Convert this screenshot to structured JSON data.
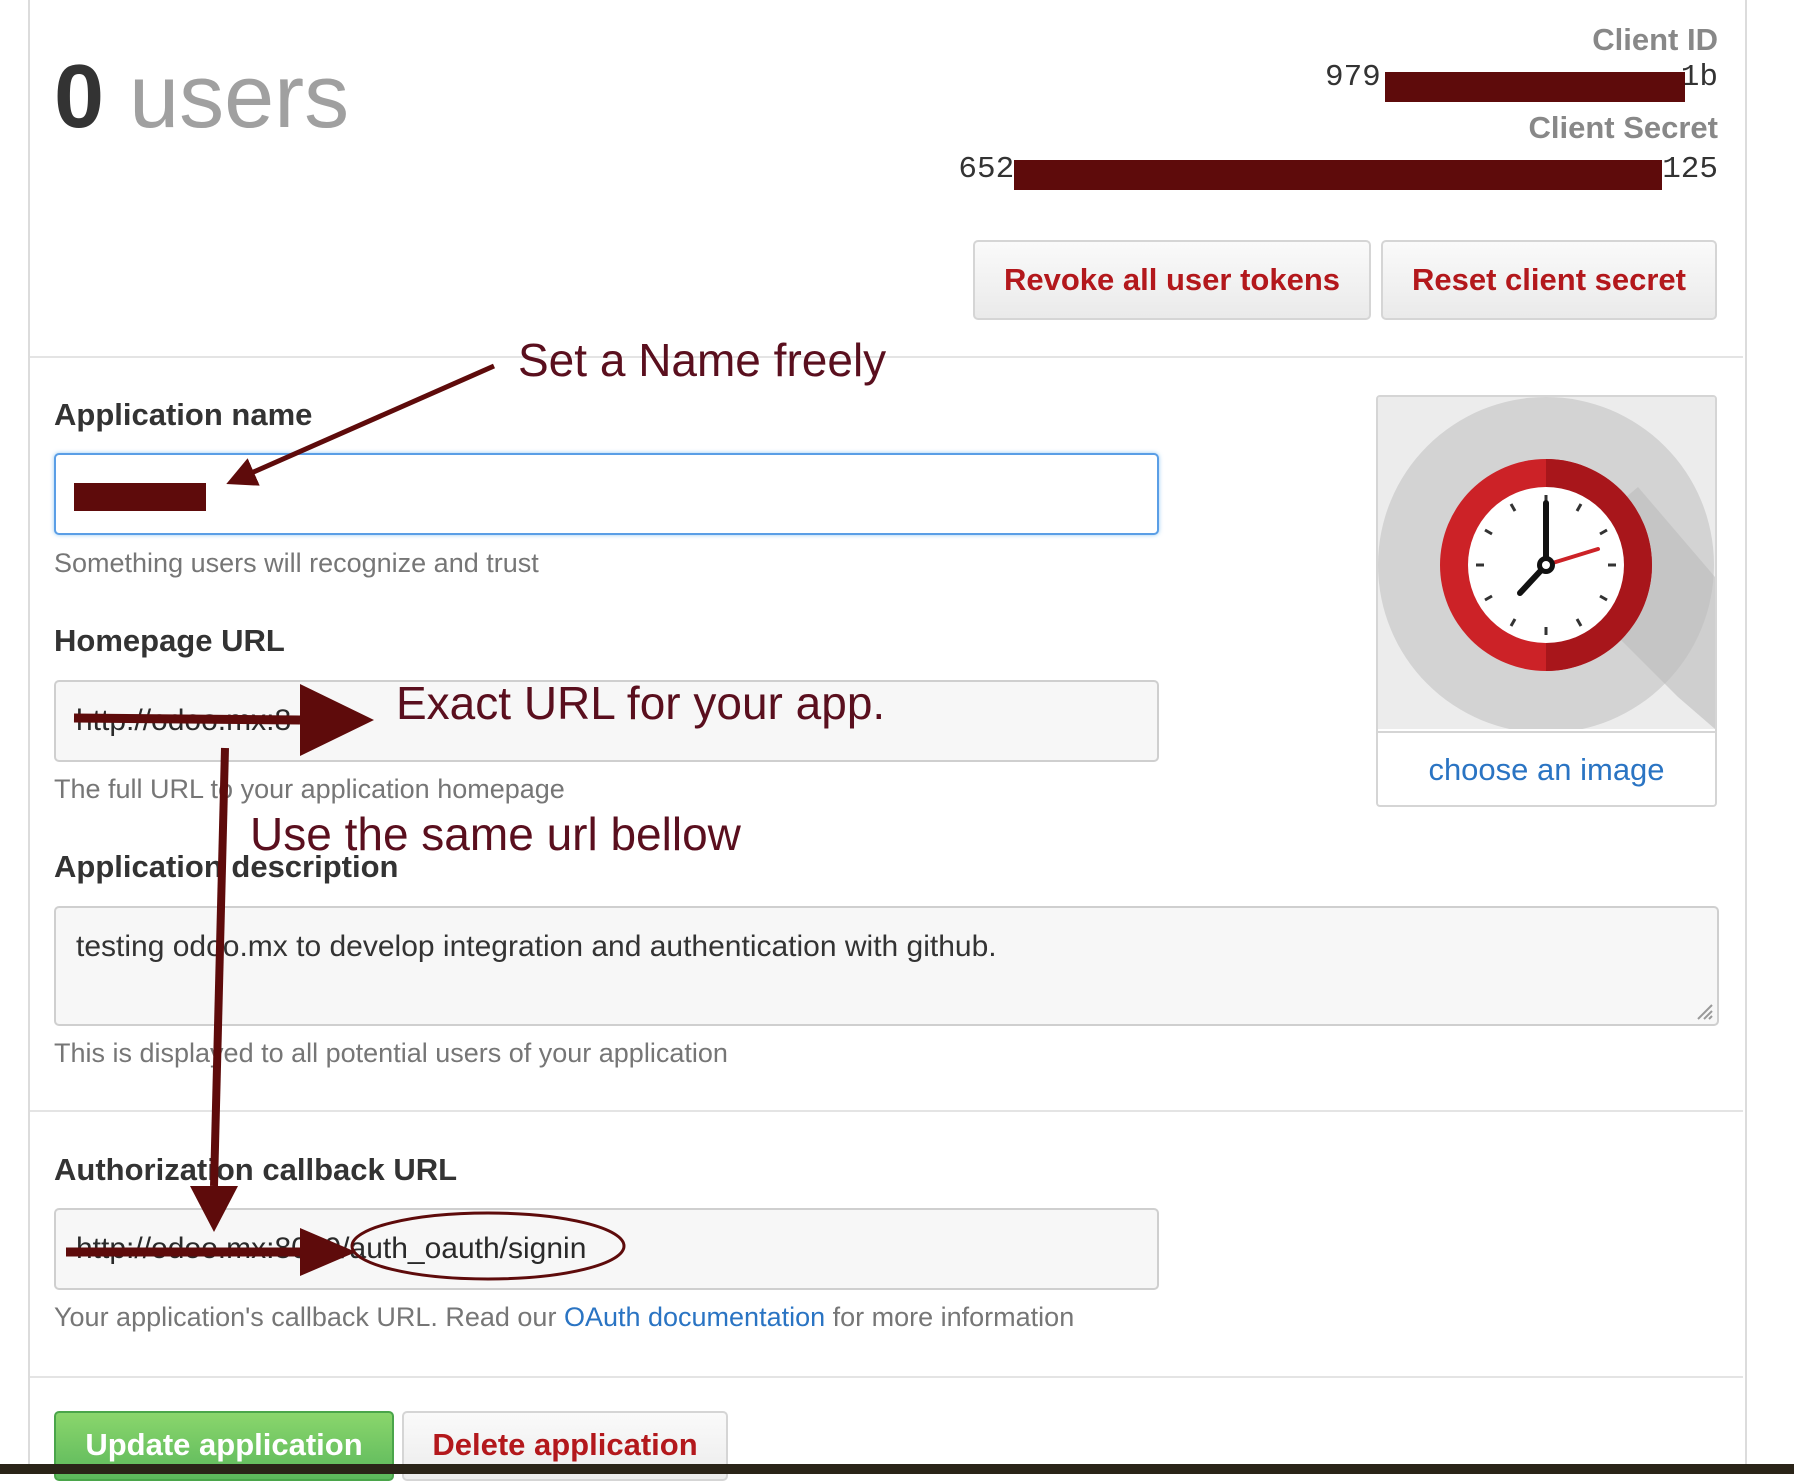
{
  "header": {
    "user_count": "0",
    "user_word": "users",
    "client_id_label": "Client ID",
    "client_id_prefix": "979",
    "client_id_suffix": "1b",
    "client_secret_label": "Client Secret",
    "client_secret_prefix": "652",
    "client_secret_suffix": "125",
    "revoke_button": "Revoke all user tokens",
    "reset_button": "Reset client secret"
  },
  "form": {
    "app_name": {
      "label": "Application name",
      "hint": "Something users will recognize and trust"
    },
    "homepage": {
      "label": "Homepage URL",
      "value": "http://odoo.mx:8",
      "hint": "The full URL to your application homepage"
    },
    "description": {
      "label": "Application description",
      "value": "testing odoo.mx to develop integration and authentication with github.",
      "hint": "This is displayed to all potential users of your application"
    },
    "callback": {
      "label": "Authorization callback URL",
      "value_prefix": "http://odoo.mx:8069/",
      "value_suffix": "auth_oauth/signin",
      "hint_before": "Your application's callback URL. Read our ",
      "hint_link": "OAuth documentation",
      "hint_after": " for more information"
    }
  },
  "avatar": {
    "caption": "choose an image",
    "icon": "clock-icon"
  },
  "actions": {
    "update_button": "Update application",
    "delete_button": "Delete application"
  },
  "annotations": {
    "name_note": "Set a Name freely",
    "url_note": "Exact URL for your app.",
    "same_url_note": "Use the same url bellow"
  },
  "colors": {
    "annotation": "#5a0f1e",
    "redaction": "#5e0b0b",
    "danger_text": "#b3181c",
    "link": "#2a74c3",
    "primary_button": "#5cb85c"
  }
}
